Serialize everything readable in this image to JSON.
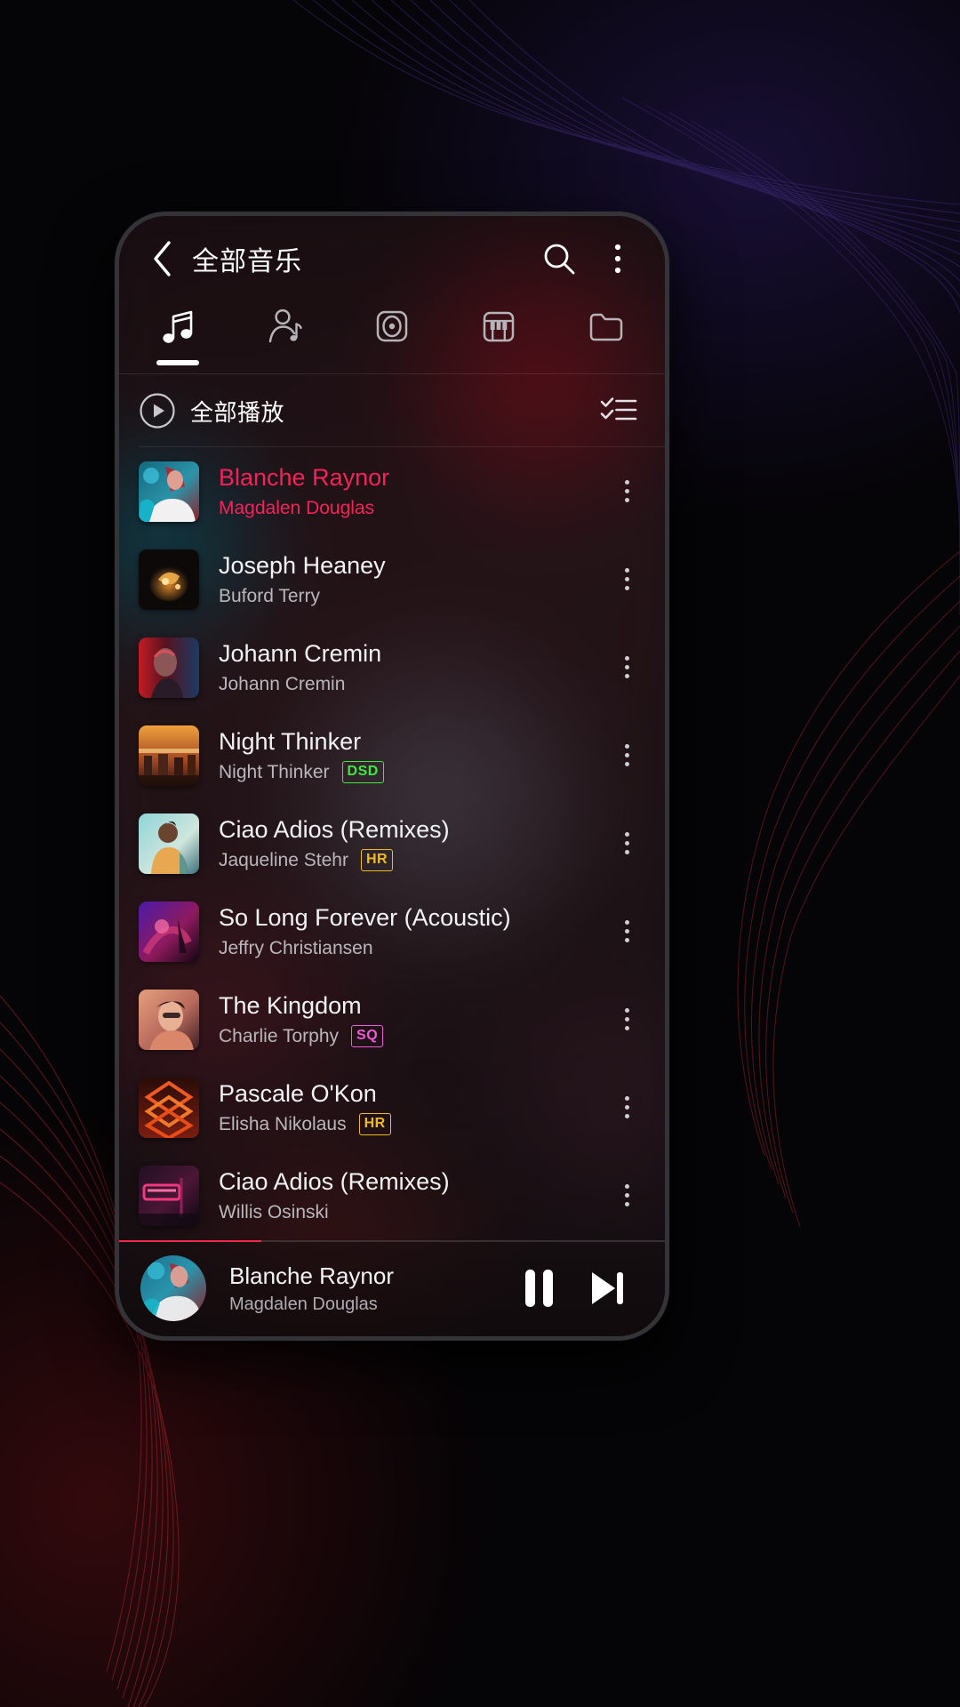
{
  "app": {
    "title": "全部音乐",
    "back_icon": "chevron-left-icon",
    "search_icon": "search-icon",
    "overflow_icon": "more-vertical-icon"
  },
  "tabs": [
    {
      "id": "songs",
      "icon": "music-note-icon",
      "active": true
    },
    {
      "id": "artists",
      "icon": "artist-icon",
      "active": false
    },
    {
      "id": "albums",
      "icon": "album-disc-icon",
      "active": false
    },
    {
      "id": "genres",
      "icon": "piano-keys-icon",
      "active": false
    },
    {
      "id": "folders",
      "icon": "folder-icon",
      "active": false
    }
  ],
  "play_all": {
    "label": "全部播放",
    "play_icon": "play-circle-icon",
    "multiselect_icon": "checklist-icon"
  },
  "songs": [
    {
      "title": "Blanche Raynor",
      "artist": "Magdalen Douglas",
      "badge": "",
      "playing": true,
      "art": "art1"
    },
    {
      "title": "Joseph Heaney",
      "artist": "Buford Terry",
      "badge": "",
      "playing": false,
      "art": "art2"
    },
    {
      "title": "Johann Cremin",
      "artist": "Johann Cremin",
      "badge": "",
      "playing": false,
      "art": "art3"
    },
    {
      "title": "Night Thinker",
      "artist": "Night Thinker",
      "badge": "DSD",
      "playing": false,
      "art": "art4"
    },
    {
      "title": "Ciao Adios (Remixes)",
      "artist": "Jaqueline Stehr",
      "badge": "HR",
      "playing": false,
      "art": "art5"
    },
    {
      "title": "So Long Forever (Acoustic)",
      "artist": "Jeffry Christiansen",
      "badge": "",
      "playing": false,
      "art": "art6"
    },
    {
      "title": "The Kingdom",
      "artist": "Charlie Torphy",
      "badge": "SQ",
      "playing": false,
      "art": "art7"
    },
    {
      "title": "Pascale O'Kon",
      "artist": "Elisha Nikolaus",
      "badge": "HR",
      "playing": false,
      "art": "art8"
    },
    {
      "title": "Ciao Adios (Remixes)",
      "artist": "Willis Osinski",
      "badge": "",
      "playing": false,
      "art": "art9"
    }
  ],
  "now_playing": {
    "title": "Blanche Raynor",
    "artist": "Magdalen Douglas",
    "pause_icon": "pause-icon",
    "next_icon": "skip-next-icon",
    "progress_percent": 26
  },
  "colors": {
    "accent": "#f5225a",
    "badge_dsd": "#3ee83e",
    "badge_hr": "#f0bb21",
    "badge_sq": "#ef5bd7",
    "text_primary": "#f2f2f4",
    "text_secondary": "#b9b7bc"
  }
}
